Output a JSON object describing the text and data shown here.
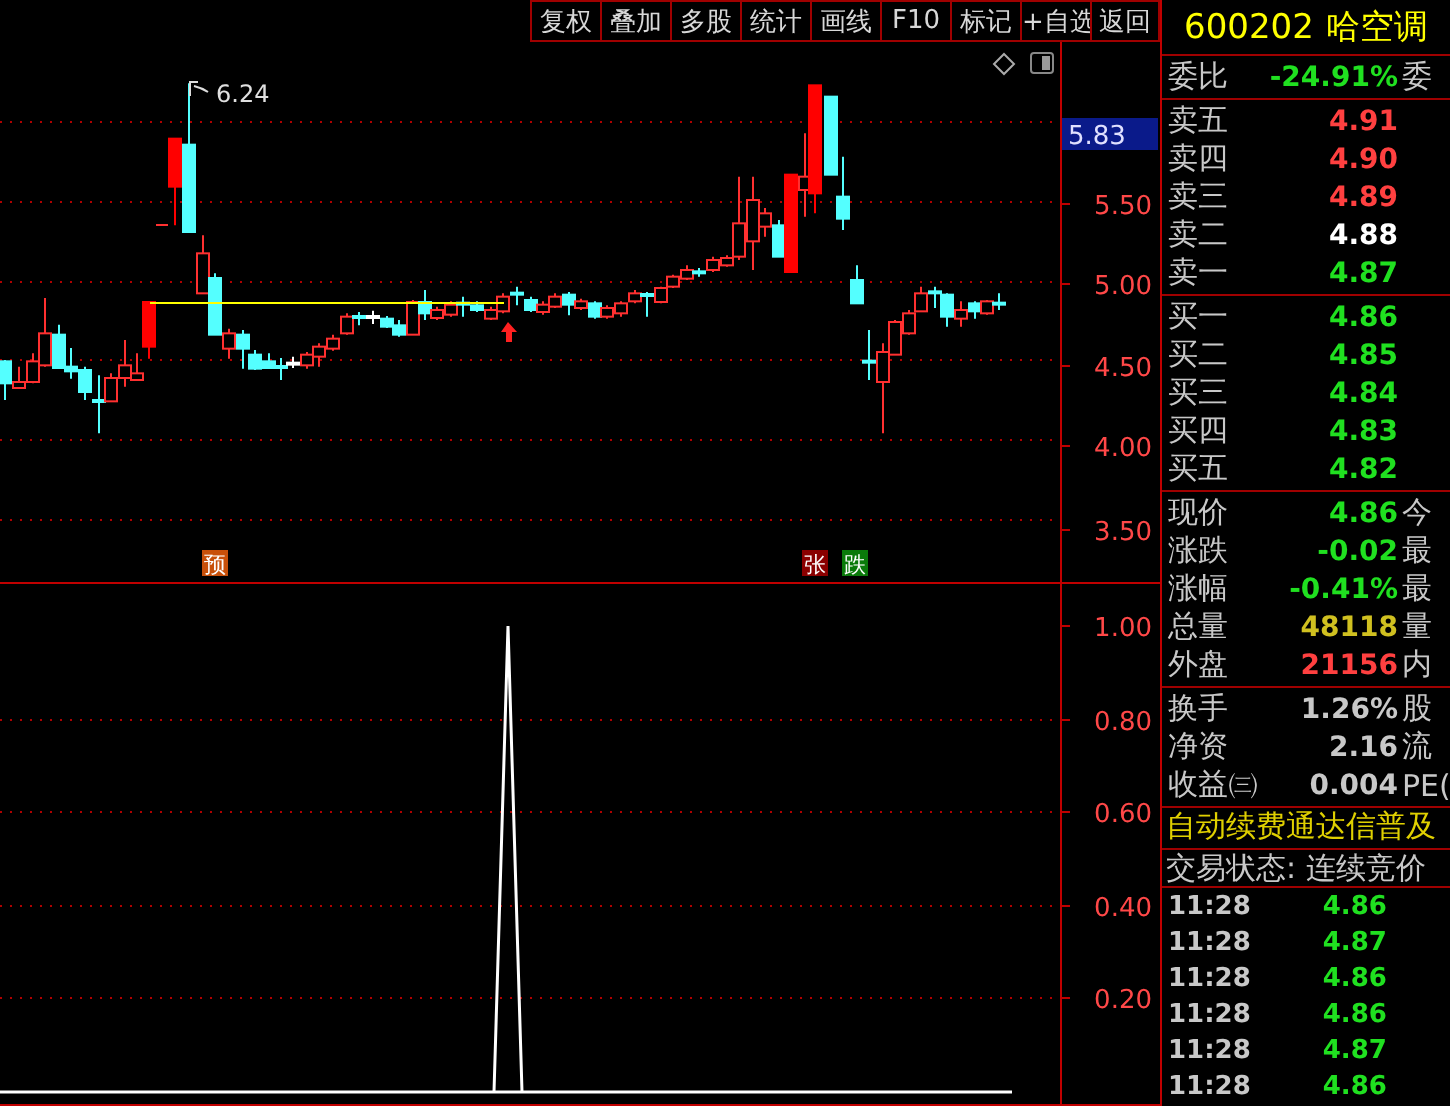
{
  "toolbar": {
    "buttons": [
      "复权",
      "叠加",
      "多股",
      "统计",
      "画线",
      "F10",
      "标记",
      "+自选",
      "返回"
    ]
  },
  "chart": {
    "price_axis_labels": [
      "5.50",
      "5.00",
      "4.50",
      "4.00",
      "3.50"
    ],
    "current_price_tag": "5.83",
    "high_label": "6.24",
    "signal_badges": [
      {
        "text": "预",
        "color": "#c8500a"
      },
      {
        "text": "张",
        "color": "#8a0000"
      },
      {
        "text": "跌",
        "color": "#0a7a0a"
      }
    ]
  },
  "indicator": {
    "axis_labels": [
      "1.00",
      "0.80",
      "0.60",
      "0.40",
      "0.20"
    ]
  },
  "quote": {
    "code": "600202",
    "name": "哈空调",
    "ratio": {
      "label": "委比",
      "value": "-24.91%",
      "extra": "委"
    },
    "asks": [
      {
        "label": "卖五",
        "price": "4.91",
        "color": "#ff4040"
      },
      {
        "label": "卖四",
        "price": "4.90",
        "color": "#ff4040"
      },
      {
        "label": "卖三",
        "price": "4.89",
        "color": "#ff4040"
      },
      {
        "label": "卖二",
        "price": "4.88",
        "color": "#ffffff"
      },
      {
        "label": "卖一",
        "price": "4.87",
        "color": "#20e020"
      }
    ],
    "bids": [
      {
        "label": "买一",
        "price": "4.86",
        "color": "#20e020"
      },
      {
        "label": "买二",
        "price": "4.85",
        "color": "#20e020"
      },
      {
        "label": "买三",
        "price": "4.84",
        "color": "#20e020"
      },
      {
        "label": "买四",
        "price": "4.83",
        "color": "#20e020"
      },
      {
        "label": "买五",
        "price": "4.82",
        "color": "#20e020"
      }
    ],
    "stats": [
      {
        "label": "现价",
        "value": "4.86",
        "color": "#20e020",
        "extra": "今"
      },
      {
        "label": "涨跌",
        "value": "-0.02",
        "color": "#20e020",
        "extra": "最"
      },
      {
        "label": "涨幅",
        "value": "-0.41%",
        "color": "#20e020",
        "extra": "最"
      },
      {
        "label": "总量",
        "value": "48118",
        "color": "#d0c020",
        "extra": "量"
      },
      {
        "label": "外盘",
        "value": "21156",
        "color": "#ff4040",
        "extra": "内"
      }
    ],
    "fundamentals": [
      {
        "label": "换手",
        "value": "1.26%",
        "extra": "股"
      },
      {
        "label": "净资",
        "value": "2.16",
        "extra": "流"
      },
      {
        "label": "收益㈢",
        "value": "0.004",
        "extra": "PE("
      }
    ],
    "notice": "自动续费通达信普及",
    "trade_status": "交易状态: 连续竞价",
    "ticks": [
      {
        "time": "11:28",
        "price": "4.86"
      },
      {
        "time": "11:28",
        "price": "4.87"
      },
      {
        "time": "11:28",
        "price": "4.86"
      },
      {
        "time": "11:28",
        "price": "4.86"
      },
      {
        "time": "11:28",
        "price": "4.87"
      },
      {
        "time": "11:28",
        "price": "4.86"
      }
    ]
  }
}
